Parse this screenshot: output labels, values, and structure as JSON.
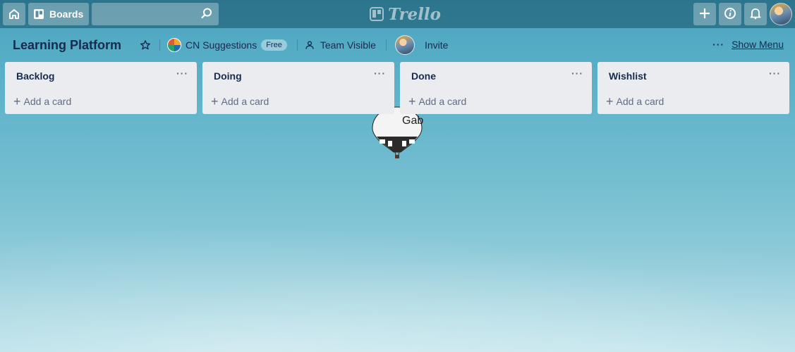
{
  "header": {
    "boards_label": "Boards",
    "search_placeholder": "",
    "logo_text": "Trello"
  },
  "board": {
    "title": "Learning Platform",
    "team_name": "CN Suggestions",
    "team_badge": "Free",
    "visibility": "Team Visible",
    "invite_label": "Invite",
    "menu_dots": "···",
    "show_menu_label": "Show Menu"
  },
  "lists": [
    {
      "title": "Backlog",
      "menu": "···",
      "add_card": "Add a card"
    },
    {
      "title": "Doing",
      "menu": "···",
      "add_card": "Add a card"
    },
    {
      "title": "Done",
      "menu": "···",
      "add_card": "Add a card"
    },
    {
      "title": "Wishlist",
      "menu": "···",
      "add_card": "Add a card"
    }
  ],
  "balloon_text": "Gab",
  "icons": {
    "home": "home-icon",
    "boards": "boards-icon",
    "search": "search-icon",
    "add": "plus-icon",
    "info": "info-icon",
    "notifications": "bell-icon",
    "star": "star-icon",
    "visibility": "team-visibility-icon"
  },
  "colors": {
    "accent_header": "#14506480",
    "list_bg": "#ebecf0",
    "text": "#172b4d",
    "muted": "#5e6c84"
  }
}
